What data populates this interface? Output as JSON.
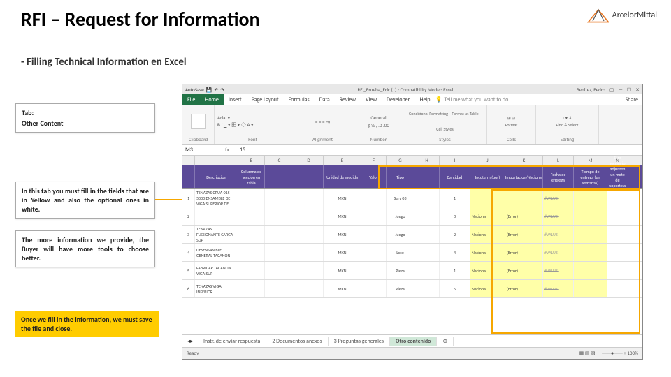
{
  "slide": {
    "title": "RFI – Request for Information",
    "subtitle": "- Filling Technical Information en Excel"
  },
  "logo": {
    "brand": "ArcelorMittal"
  },
  "callouts": {
    "tab_label": "Tab:",
    "tab_name": "Other Content",
    "desc1": "In this tab you must fill in the fields that are in Yellow and also the optional ones in white.",
    "desc2": "The more information we provide, the Buyer will have more tools to choose better.",
    "final": "Once we fill in the information, we must save the file and close."
  },
  "excel": {
    "user": "Benitez, Pedro",
    "doc": "RFI_Prueba_Eric (1) - Compatibility Mode - Excel",
    "ribbon_file": "File",
    "ribbon_tabs": [
      "Home",
      "Insert",
      "Page Layout",
      "Formulas",
      "Data",
      "Review",
      "View",
      "Developer",
      "Help"
    ],
    "tell_me": "Tell me what you want to do",
    "share": "Share",
    "groups": {
      "clipboard": "Clipboard",
      "font": "Font",
      "alignment": "Alignment",
      "number": "Number",
      "styles": "Styles",
      "cells": "Cells",
      "editing": "Editing",
      "font_name": "Arial",
      "number_fmt": "General",
      "cond": "Conditional Formatting",
      "fmt_table": "Format as Table",
      "cell_styles": "Cell Styles",
      "format": "Format",
      "find": "Find & Select"
    },
    "name_box": "M3",
    "fx": "fx",
    "formula_value": "15",
    "col_letters": [
      "",
      "",
      "B",
      "C",
      "D",
      "E",
      "F",
      "G",
      "H",
      "I",
      "J",
      "K",
      "L",
      "M",
      "N",
      ""
    ],
    "headers": [
      "",
      "Descripcion",
      "Columna de seccion en tabla",
      "",
      "",
      "Unidad de medida",
      "Valor",
      "Tipo",
      "",
      "Cantidad",
      "Incoterm (por)",
      "Importacion/Nacional",
      "Fecha de entrega",
      "Tiempo de entrega (en semanas)",
      "Si es necesario, adjunten un mote de soporte a su respuesta"
    ],
    "rows": [
      {
        "n": "1",
        "desc": "TENAZAS CRUA 015 5000 ENSAMBLE DE VIGA SUPERIOR DE",
        "unid": "MXN",
        "tipo": "Serv 03",
        "cant": "1",
        "inco": "",
        "imp": "",
        "fecha": "#VALUE!",
        "strike": true
      },
      {
        "n": "2",
        "desc": "",
        "unid": "MXN",
        "tipo": "Juego",
        "cant": "3",
        "inco": "Nacional",
        "imp": "(Error)",
        "fecha": "#VALUE!",
        "strike": true
      },
      {
        "n": "3",
        "desc": "TENAZAS FLEXIONANTE CARGA SUP",
        "unid": "MXN",
        "tipo": "Juego",
        "cant": "2",
        "inco": "Nacional",
        "imp": "(Error)",
        "fecha": "#VALUE!",
        "strike": true
      },
      {
        "n": "4",
        "desc": "DESENSAMBLE GENERAL TACANON",
        "unid": "MXN",
        "tipo": "Lote",
        "cant": "4",
        "inco": "Nacional",
        "imp": "(Error)",
        "fecha": "#VALUE!",
        "strike": true
      },
      {
        "n": "5",
        "desc": "FABRICAR TACANON VIGA SUP",
        "unid": "MXN",
        "tipo": "Pieza",
        "cant": "1",
        "inco": "Nacional",
        "imp": "(Error)",
        "fecha": "#VALUE!",
        "strike": true
      },
      {
        "n": "6",
        "desc": "TENAZAS VIGA INFERIOR",
        "unid": "MXN",
        "tipo": "Pieza",
        "cant": "5",
        "inco": "Nacional",
        "imp": "(Error)",
        "fecha": "#VALUE!",
        "strike": true
      }
    ],
    "sheet_tabs": [
      "Instr. de enviar respuesta",
      "2 Documentos anexos",
      "3 Preguntas generales",
      "Otro contenido"
    ],
    "status": "Ready",
    "zoom": "100%"
  }
}
